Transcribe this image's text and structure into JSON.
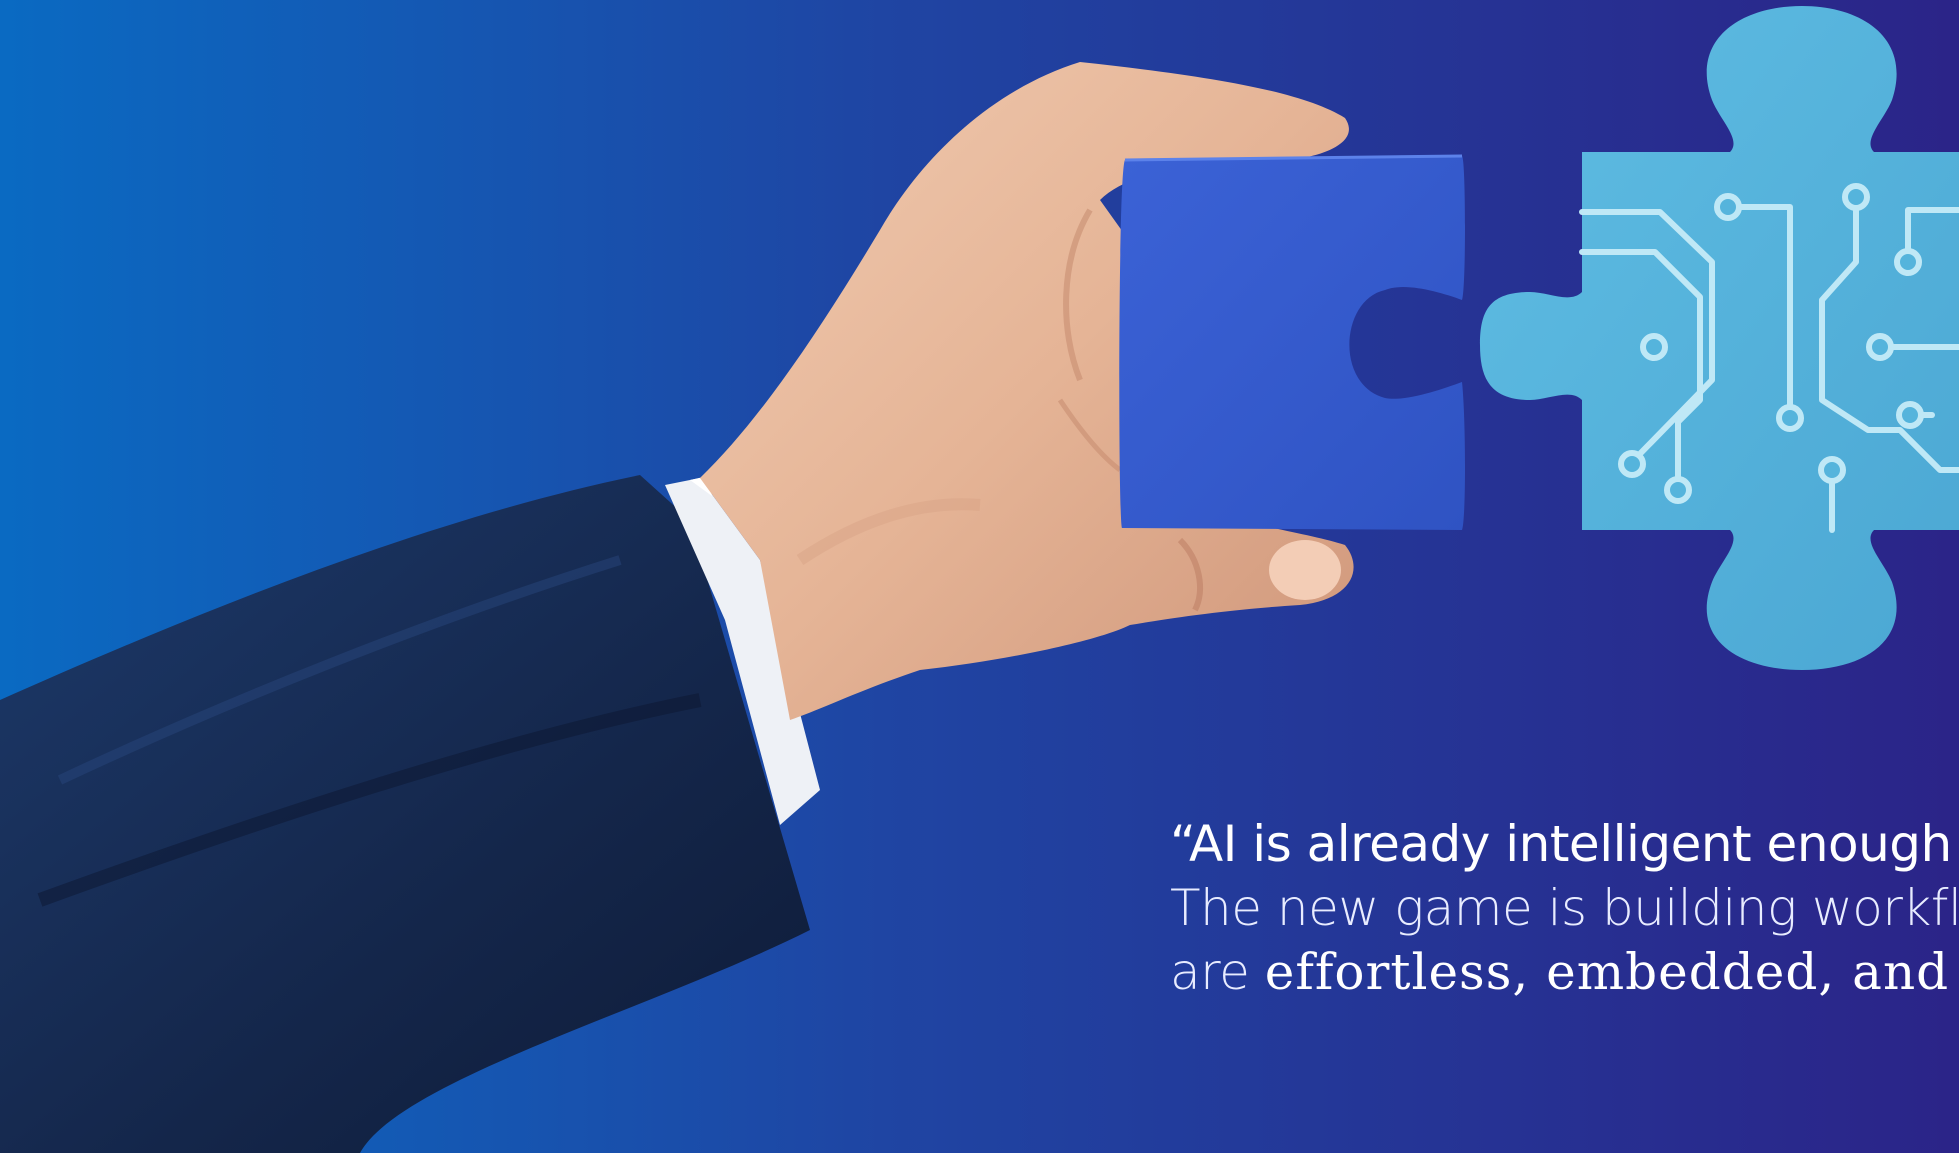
{
  "colors": {
    "bg_left": "#0a6ac2",
    "bg_mid": "#1f45a3",
    "bg_right": "#2b2488",
    "sleeve": "#16294f",
    "cuff": "#eef1f6",
    "skin": "#e7b89b",
    "held_piece": "#3a5fd1",
    "circuit_piece": "#55b4dc",
    "circuit_trace": "#bfe8f6",
    "text": "#ffffff"
  },
  "illustration": {
    "hand_image": "hand-in-suit-sleeve-holding-puzzle-piece",
    "held_piece_icon": "puzzle-piece-icon",
    "circuit_piece_icon": "circuit-board-puzzle-piece-icon"
  },
  "quote": {
    "line1": "“AI is already intelligent enough fo",
    "line2": "The new game is building workflov",
    "line3_prefix": "are ",
    "line3_emphasis": "effortless, embedded, and i"
  }
}
